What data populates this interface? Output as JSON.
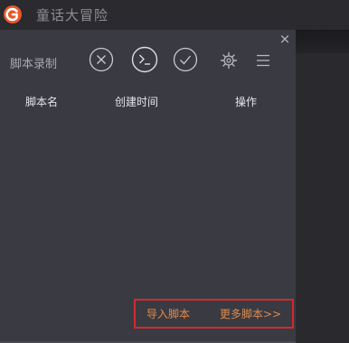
{
  "app": {
    "title": "童话大冒险"
  },
  "toolbar": {
    "label": "脚本录制",
    "close_glyph": "×"
  },
  "table": {
    "columns": [
      "脚本名",
      "创建时间",
      "操作"
    ]
  },
  "footer": {
    "import_label": "导入脚本",
    "more_label": "更多脚本>>"
  },
  "colors": {
    "panel_bg": "#3a3a42",
    "title_bg": "#2a2a2f",
    "accent_orange": "#e08a4a",
    "highlight_red": "#d22a2a",
    "logo_orange": "#e8582a"
  }
}
